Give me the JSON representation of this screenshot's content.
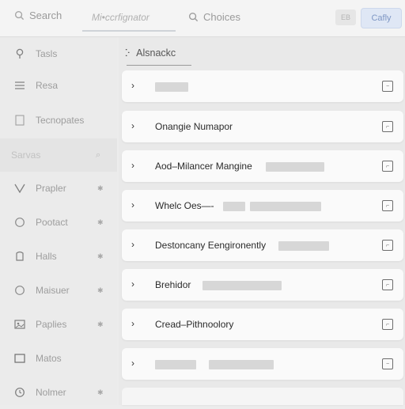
{
  "topbar": {
    "search_label": "Search",
    "segment_label": "Mi•ccrfignator",
    "choices_label": "Choices",
    "ghost_button": "EB",
    "primary_button": "Cafly"
  },
  "sidebar": {
    "items": [
      {
        "label": "Tasls",
        "icon": "pin-icon"
      },
      {
        "label": "Resa",
        "icon": "list-icon"
      },
      {
        "label": "Tecnopates",
        "icon": "template-icon"
      },
      {
        "label": "Sarvas",
        "icon": "blank-icon",
        "selected": true
      },
      {
        "label": "Prapler",
        "icon": "chevron-v-icon"
      },
      {
        "label": "Pootact",
        "icon": "circle-icon"
      },
      {
        "label": "Halls",
        "icon": "tag-icon"
      },
      {
        "label": "Maisuer",
        "icon": "circle-icon"
      },
      {
        "label": "Paplies",
        "icon": "image-icon"
      },
      {
        "label": "Matos",
        "icon": "card-icon"
      },
      {
        "label": "Nolmer",
        "icon": "clock-icon"
      }
    ]
  },
  "main": {
    "breadcrumb": "Alsnackc",
    "rows": [
      {
        "text": ""
      },
      {
        "text": "Onangie Numapor"
      },
      {
        "text": "Aod–Milancer Mangine"
      },
      {
        "text": "Whelc Oes—-"
      },
      {
        "text": "Destoncany Eengironently"
      },
      {
        "text": "Brehidor"
      },
      {
        "text": "Cread–Pithnoolory"
      },
      {
        "text": ""
      }
    ]
  }
}
